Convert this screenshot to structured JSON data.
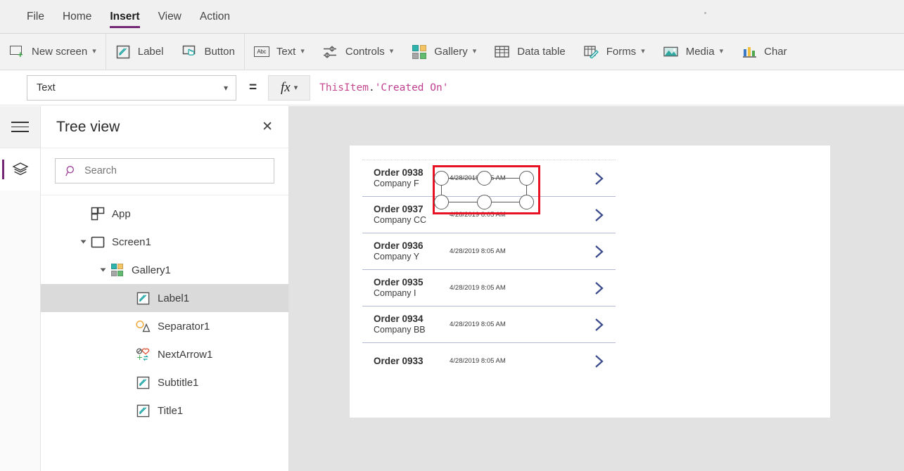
{
  "menu": {
    "items": [
      {
        "label": "File",
        "active": false
      },
      {
        "label": "Home",
        "active": false
      },
      {
        "label": "Insert",
        "active": true
      },
      {
        "label": "View",
        "active": false
      },
      {
        "label": "Action",
        "active": false
      }
    ],
    "accent_color": "#742774"
  },
  "ribbon": {
    "groups": [
      {
        "label": "New screen",
        "icon": "new-screen-icon",
        "caret": true
      },
      {
        "label": "Label",
        "icon": "label-pencil-icon",
        "caret": false
      },
      {
        "label": "Button",
        "icon": "button-icon",
        "caret": false
      },
      {
        "label": "Text",
        "icon": "text-abc-icon",
        "caret": true
      },
      {
        "label": "Controls",
        "icon": "controls-sliders-icon",
        "caret": true
      },
      {
        "label": "Gallery",
        "icon": "gallery-grid-icon",
        "caret": true
      },
      {
        "label": "Data table",
        "icon": "data-table-icon",
        "caret": false
      },
      {
        "label": "Forms",
        "icon": "forms-icon",
        "caret": true
      },
      {
        "label": "Media",
        "icon": "media-image-icon",
        "caret": true
      },
      {
        "label": "Char",
        "icon": "chart-bar-icon",
        "caret": false
      }
    ],
    "gallery_icon_colors": [
      "#2fb3ad",
      "#f5c465",
      "#a6a6a6",
      "#62bb6e"
    ],
    "chart_icon_colors": [
      "#3b78c4",
      "#f0c040",
      "#4ea64e"
    ]
  },
  "property_bar": {
    "selected_property": "Text",
    "equals_sign": "=",
    "fx_label": "fx",
    "formula": {
      "full": "ThisItem.'Created On'",
      "tokens": [
        {
          "text": "ThisItem",
          "kind": "identifier"
        },
        {
          "text": ".",
          "kind": "operator"
        },
        {
          "text": "'Created On'",
          "kind": "string"
        }
      ]
    },
    "identifier_color": "#c5488f",
    "string_color": "#be3d8e"
  },
  "rail": {
    "hamburger_tooltip": "Menu",
    "buttons": [
      {
        "name": "tree-view-layers",
        "selected": true
      }
    ]
  },
  "tree_panel": {
    "title": "Tree view",
    "close_label": "✕",
    "search": {
      "placeholder": "Search",
      "value": ""
    },
    "nodes": [
      {
        "label": "App",
        "indent": 0,
        "icon": "app-icon",
        "twisty": "none",
        "selected": false
      },
      {
        "label": "Screen1",
        "indent": 0,
        "icon": "screen-icon",
        "twisty": "expanded",
        "selected": false
      },
      {
        "label": "Gallery1",
        "indent": 1,
        "icon": "gallery-icon",
        "twisty": "expanded",
        "selected": false
      },
      {
        "label": "Label1",
        "indent": 2,
        "icon": "label-icon",
        "twisty": "none",
        "selected": true
      },
      {
        "label": "Separator1",
        "indent": 2,
        "icon": "separator-icon",
        "twisty": "none",
        "selected": false
      },
      {
        "label": "NextArrow1",
        "indent": 2,
        "icon": "nextarrow-icon",
        "twisty": "none",
        "selected": false
      },
      {
        "label": "Subtitle1",
        "indent": 2,
        "icon": "label-icon",
        "twisty": "none",
        "selected": false
      },
      {
        "label": "Title1",
        "indent": 2,
        "icon": "label-icon",
        "twisty": "none",
        "selected": false
      }
    ]
  },
  "canvas": {
    "background_color": "#e2e2e2",
    "screen_background": "#ffffff",
    "selection_outline_color": "#e81123",
    "gallery": {
      "rows": [
        {
          "title": "Order 0938",
          "subtitle": "Company F",
          "date": "4/28/2019 8:05 AM",
          "chevron": true,
          "selected_row": true
        },
        {
          "title": "Order 0937",
          "subtitle": "Company CC",
          "date": "4/28/2019 8:05 AM",
          "chevron": true,
          "selected_row": false
        },
        {
          "title": "Order 0936",
          "subtitle": "Company Y",
          "date": "4/28/2019 8:05 AM",
          "chevron": true,
          "selected_row": false
        },
        {
          "title": "Order 0935",
          "subtitle": "Company I",
          "date": "4/28/2019 8:05 AM",
          "chevron": true,
          "selected_row": false
        },
        {
          "title": "Order 0934",
          "subtitle": "Company BB",
          "date": "4/28/2019 8:05 AM",
          "chevron": true,
          "selected_row": false
        },
        {
          "title": "Order 0933",
          "subtitle": "",
          "date": "4/28/2019 8:05 AM",
          "chevron": true,
          "selected_row": false
        }
      ],
      "chevron_color": "#3a4a8c",
      "separator_color": "#b5bbd4"
    }
  }
}
